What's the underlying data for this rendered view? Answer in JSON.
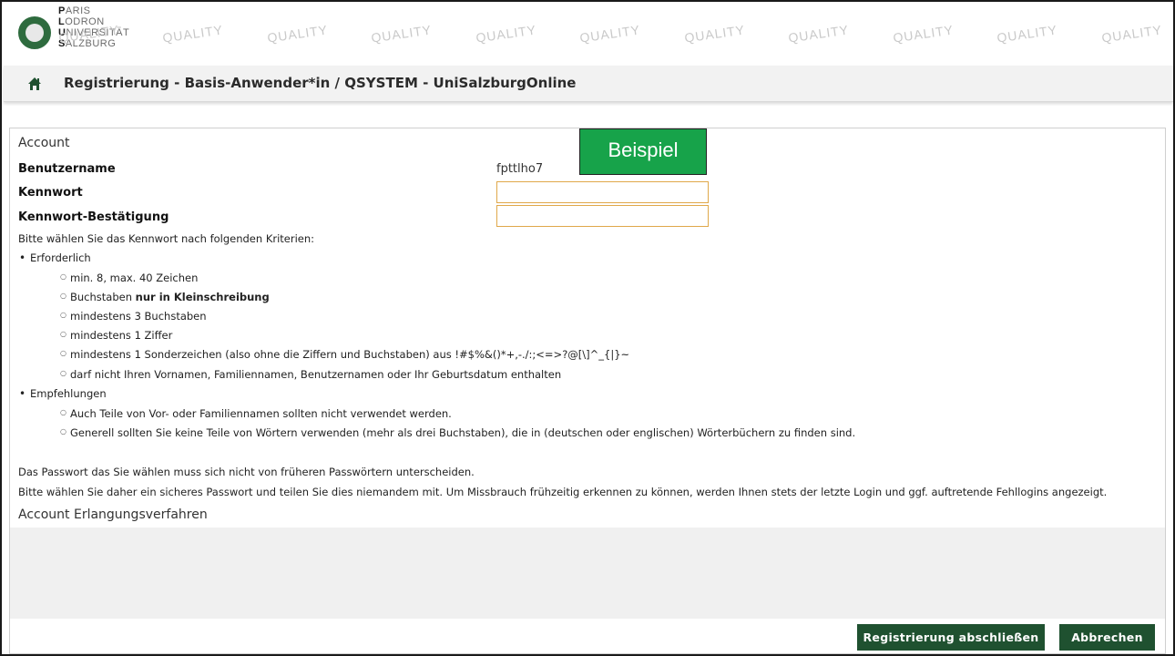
{
  "header": {
    "logo_lines": [
      {
        "initial": "P",
        "rest": "ARIS"
      },
      {
        "initial": "L",
        "rest": "ODRON"
      },
      {
        "initial": "U",
        "rest": "NIVERSITÄT"
      },
      {
        "initial": "S",
        "rest": "ALZBURG"
      }
    ],
    "watermark_text": "QUALITY",
    "title": "Registrierung - Basis-Anwender*in  / QSYSTEM - UniSalzburgOnline",
    "home_icon": "home-icon"
  },
  "account": {
    "section_title": "Account",
    "username_label": "Benutzername",
    "username_value": "fpttlho7",
    "password_label": "Kennwort",
    "password_confirm_label": "Kennwort-Bestätigung",
    "example_badge": "Beispiel"
  },
  "criteria": {
    "intro": "Bitte wählen Sie das Kennwort nach folgenden Kriterien:",
    "required_heading": "Erforderlich",
    "required_items": [
      "min. 8, max. 40 Zeichen",
      "Buchstaben ",
      "mindestens 3 Buchstaben",
      "mindestens 1 Ziffer",
      "mindestens 1 Sonderzeichen (also ohne die Ziffern und Buchstaben) aus !#$%&()*+,-./:;<=>?@[\\]^_{|}~",
      "darf nicht Ihren Vornamen, Familiennamen, Benutzernamen oder Ihr Geburtsdatum enthalten"
    ],
    "required_item_2_bold": "nur in Kleinschreibung",
    "recommend_heading": "Empfehlungen",
    "recommend_items": [
      "Auch Teile von Vor- oder Familiennamen sollten nicht verwendet werden.",
      "Generell sollten Sie keine Teile von Wörtern verwenden (mehr als drei Buchstaben), die in (deutschen oder englischen) Wörterbüchern zu finden sind."
    ],
    "note_1": "Das Passwort das Sie wählen muss sich nicht von früheren Passwörtern unterscheiden.",
    "note_2": "Bitte wählen Sie daher ein sicheres Passwort und teilen Sie dies niemandem mit. Um Missbrauch frühzeitig erkennen zu können, werden Ihnen stets der letzte Login und ggf. auftretende Fehllogins angezeigt."
  },
  "recovery": {
    "section_title": "Account Erlangungsverfahren"
  },
  "footer": {
    "submit_label": "Registrierung abschließen",
    "cancel_label": "Abbrechen"
  },
  "colors": {
    "brand_green": "#1f5130",
    "badge_green": "#17a34a",
    "input_border": "#e0a84a"
  }
}
